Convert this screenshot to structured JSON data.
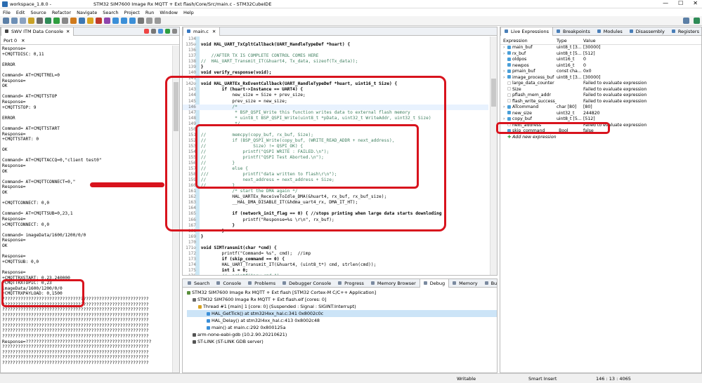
{
  "window": {
    "workspace": "workspace_1.8.0 -",
    "title": "STM32 SIM7600     Image Rx MQTT + Ext flash/Core/Src/main.c - STM32CubeIDE",
    "min": "—",
    "max": "☐",
    "close": "✕"
  },
  "menu": [
    "File",
    "Edit",
    "Source",
    "Refactor",
    "Navigate",
    "Search",
    "Project",
    "Run",
    "Window",
    "Help"
  ],
  "left_panel": {
    "tab_label": "SWV ITM Data Console",
    "port_tab": "Port 0",
    "lines": [
      "Response=",
      "+CMQTTDISC: 0,11",
      "",
      "ERROR",
      "",
      "Command= AT+CMQTTREL=0",
      "Response=",
      "OK",
      "",
      "Command= AT+CMQTTSTOP",
      "Response=",
      "+CMQTTSTOP: 9",
      "",
      "ERROR",
      "",
      "Command= AT+CMQTTSTART",
      "Response=",
      "+CMQTTSTART: 0",
      "",
      "OK",
      "",
      "Command= AT+CMQTTACCQ=0,\"client test0\"",
      "Response=",
      "OK",
      "",
      "Command= AT+CMQTTCONNECT=0,\"",
      "Response=",
      "OK",
      "",
      "+CMQTTCONNECT: 0,0",
      "",
      "Command= AT+CMQTTSUB=0,23,1",
      "Response=",
      ">CMQTTCONNECT: 0,0",
      "",
      "Command= imageData/1600/1200/0/0",
      "Response=",
      "OK",
      "",
      "Response=",
      "+CMQTTSUB: 0,0",
      "",
      "Response=",
      "+CMQTTRXSTART: 0,23,240000",
      "+CMQTTRXTOPIC: 0,23",
      "imageData/1600/1200/0/0",
      "+CMQTTRXPAYLOAD: 0,1500",
      "????????????????????????????????????????????????????????",
      "????????????????????????????????????????????????????????",
      "????????????????????????????????????????????????????????",
      "????????????????????????????????????????????????????????",
      "????????????????????????????????????????????????????????",
      "????????????????????????????????????????????????????????",
      "????????????????????????????????????????????????????????",
      "????????????????????????????????????????????????????????",
      "Response=????????????????????????????????????????????????",
      "????????????????????????????????????????????????????????",
      "????????????????????????????????????????????????????????",
      "????????????????????????????????????????????????????????",
      "????????????????????????????????????????????????????????"
    ]
  },
  "editor": {
    "tab_label": "main.c",
    "close": "✕",
    "lines": [
      {
        "n": "134",
        "text": ""
      },
      {
        "n": "135⊖",
        "text": "void HAL_UART_TxCpltCallback(UART_HandleTypeDef *huart) {"
      },
      {
        "n": "136",
        "text": ""
      },
      {
        "n": "137",
        "text": "    //AFTER TX IS COMPLETE CONTROL COMES HERE"
      },
      {
        "n": "138",
        "text": "//  HAL_UART_Transmit_IT(&huart4, Tx_data, sizeof(Tx_data));"
      },
      {
        "n": "139",
        "text": "}"
      },
      {
        "n": "140",
        "text": "void verify_response(void);"
      },
      {
        "n": "141",
        "text": ""
      },
      {
        "n": "142⊖",
        "text": "void HAL_UARTEx_RxEventCallback(UART_HandleTypeDef *huart, uint16_t Size) {"
      },
      {
        "n": "143",
        "text": "        if (huart->Instance == UART4) {"
      },
      {
        "n": "144",
        "text": "            new_size = Size + prev_size;"
      },
      {
        "n": "145",
        "text": "            prev_size = new_size;"
      },
      {
        "n": "146",
        "text": "            /*"
      },
      {
        "n": "147",
        "text": "             * BSP_QSPI_Write this function writes data to external flash memory"
      },
      {
        "n": "148",
        "text": "             * uint8_t BSP_QSPI_Write(uint8_t *pData, uint32_t WriteAddr, uint32_t Size)"
      },
      {
        "n": "149",
        "text": "             */"
      },
      {
        "n": "150",
        "text": ""
      },
      {
        "n": "151",
        "text": "//          memcpy(copy_buf, rx_buf, Size);"
      },
      {
        "n": "152",
        "text": "//          if (BSP_QSPI_Write(copy_buf, (WRITE_READ_ADDR + next_address),"
      },
      {
        "n": "153",
        "text": "//                  Size) != QSPI_OK) {"
      },
      {
        "n": "154",
        "text": "//              printf(\"QSPI WRITE : FAILED.\\n\");"
      },
      {
        "n": "155",
        "text": "//              printf(\"QSPI Test Aborted.\\n\");"
      },
      {
        "n": "156",
        "text": "//          }"
      },
      {
        "n": "157",
        "text": "//          else {"
      },
      {
        "n": "158",
        "text": "///             printf(\"data written to flash\\r\\n\");"
      },
      {
        "n": "159",
        "text": "//              next_address = next_address + Size;"
      },
      {
        "n": "160",
        "text": "//          }"
      },
      {
        "n": "161",
        "text": "            /* start the DMA again */"
      },
      {
        "n": "162",
        "text": "            HAL_UARTEx_ReceiveToIdle_DMA(&huart4, rx_buf, rx_buf_size);"
      },
      {
        "n": "163",
        "text": "            __HAL_DMA_DISABLE_IT(&hdma_uart4_rx, DMA_IT_HT);"
      },
      {
        "n": "164",
        "text": ""
      },
      {
        "n": "165",
        "text": "            if (network_init_flag == 0) { //stops printing when large data starts downloding"
      },
      {
        "n": "166",
        "text": "                printf(\"Response=%s \\r\\n\", rx_buf);"
      },
      {
        "n": "167",
        "text": "            }"
      },
      {
        "n": "168",
        "text": "        }"
      },
      {
        "n": "169",
        "text": "}"
      },
      {
        "n": "170",
        "text": ""
      },
      {
        "n": "171⊖",
        "text": "void SIMTransmit(char *cmd) {"
      },
      {
        "n": "172",
        "text": "        printf(\"Command= %s\", cmd);  //imp"
      },
      {
        "n": "173",
        "text": "        if (skip_command == 0) {"
      },
      {
        "n": "174",
        "text": "        HAL_UART_Transmit_IT(&huart4, (uint8_t*) cmd, strlen(cmd));"
      },
      {
        "n": "175",
        "text": "        int i = 0;"
      },
      {
        "n": "176",
        "text": "        //  printf(\"new_cmd=\");"
      }
    ]
  },
  "bottom_tabs": [
    "Search",
    "Console",
    "Problems",
    "Debugger Console",
    "Progress",
    "Memory Browser",
    "Debug",
    "Memory",
    "Build Analyzer"
  ],
  "debug_tree": [
    "STM32 SIM7600     Image Rx MQTT + Ext flash [STM32 Cortex-M C/C++ Application]",
    "STM32 SIM7600     Image Rx MQTT + Ext flash.elf [cores: 0]",
    "Thread #1 [main] 1 [core: 0] (Suspended : Signal : SIGINT:Interrupt)",
    "HAL_GetTick() at stm32l4xx_hal.c:341 0x8002c0c",
    "HAL_Delay() at stm32l4xx_hal.c:413 0x8002c48",
    "main() at main.c:292 0x800125a",
    "arm-none-eabi-gdb (10.2.90.20210621)",
    "ST-LINK (ST-LINK GDB server)"
  ],
  "right_tabs": [
    "Live Expressions",
    "Breakpoints",
    "Modules",
    "Disassembly",
    "Registers"
  ],
  "expressions": {
    "headers": [
      "Expression",
      "Type",
      "Value"
    ],
    "rows": [
      {
        "name": "main_buf",
        "type": "uint8_t [3...",
        "value": "[30000]",
        "tw": "›",
        "color": "#4a9fd8"
      },
      {
        "name": "rx_buf",
        "type": "uint8_t [5...",
        "value": "[512]",
        "tw": "›",
        "color": "#4a9fd8"
      },
      {
        "name": "oldpos",
        "type": "uint16_t",
        "value": "0",
        "tw": "",
        "color": "#4a9fd8"
      },
      {
        "name": "newpos",
        "type": "uint16_t",
        "value": "0",
        "tw": "",
        "color": "#4a9fd8"
      },
      {
        "name": "pmain_buf",
        "type": "const cha...",
        "value": "0x0",
        "tw": "›",
        "color": "#4a9fd8"
      },
      {
        "name": "image_process_buf",
        "type": "uint8_t [3...",
        "value": "[30000]",
        "tw": "›",
        "color": "#4a9fd8"
      },
      {
        "name": "large_data_counter",
        "type": "",
        "value": "Failed to evaluate expression",
        "tw": "",
        "color": "#ffffff"
      },
      {
        "name": "Size",
        "type": "",
        "value": "Failed to evaluate expression",
        "tw": "",
        "color": "#ffffff"
      },
      {
        "name": "pflash_mem_addr",
        "type": "",
        "value": "Failed to evaluate expression",
        "tw": "",
        "color": "#ffffff"
      },
      {
        "name": "flash_write_success_c",
        "type": "",
        "value": "Failed to evaluate expression",
        "tw": "",
        "color": "#ffffff"
      },
      {
        "name": "ATcommand",
        "type": "char [80]",
        "value": "[80]",
        "tw": "›",
        "color": "#4a9fd8"
      },
      {
        "name": "new_size",
        "type": "uint32_t",
        "value": "244820",
        "tw": "",
        "color": "#4a9fd8"
      },
      {
        "name": "copy_buf",
        "type": "uint8_t [5...",
        "value": "[512]",
        "tw": "›",
        "color": "#4a9fd8"
      },
      {
        "name": "next_address",
        "type": "",
        "value": "Failed to evaluate expression",
        "tw": "",
        "color": "#ffffff"
      },
      {
        "name": "skip_command",
        "type": "_Bool",
        "value": "false",
        "tw": "",
        "color": "#4a9fd8"
      }
    ],
    "add_new": "Add new expression"
  },
  "status": {
    "writable": "Writable",
    "insert": "Smart Insert",
    "position": "146 : 13 : 4065"
  },
  "colors": {
    "annotation_red": "#d8131d",
    "keyword": "#7f0055",
    "comment": "#3f7f5f",
    "string": "#2a00ff"
  }
}
